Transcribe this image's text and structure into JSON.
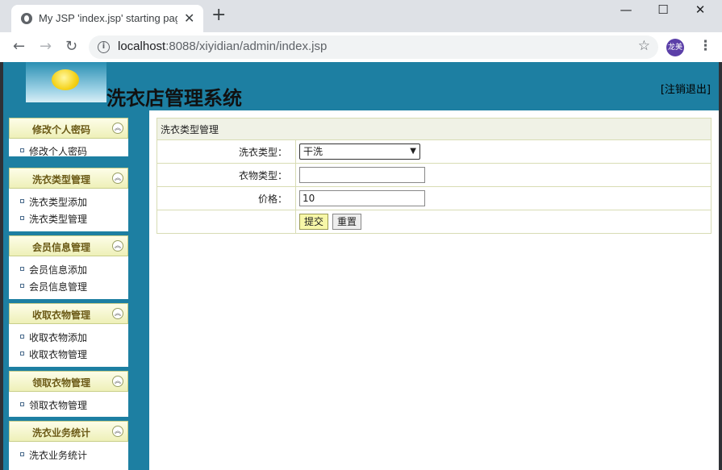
{
  "browser": {
    "tab_title": "My JSP 'index.jsp' starting page",
    "tab_close": "✕",
    "new_tab": "+",
    "url_host": "localhost",
    "url_rest": ":8088/xiyidian/admin/index.jsp",
    "profile_label": "龙美",
    "win_min": "—",
    "win_max": "☐",
    "win_close": "✕"
  },
  "header": {
    "title": "洗衣店管理系统",
    "logout": "[注销退出]"
  },
  "sidebar": {
    "groups": [
      {
        "title": "修改个人密码",
        "items": [
          "修改个人密码"
        ]
      },
      {
        "title": "洗衣类型管理",
        "items": [
          "洗衣类型添加",
          "洗衣类型管理"
        ]
      },
      {
        "title": "会员信息管理",
        "items": [
          "会员信息添加",
          "会员信息管理"
        ]
      },
      {
        "title": "收取衣物管理",
        "items": [
          "收取衣物添加",
          "收取衣物管理"
        ]
      },
      {
        "title": "领取衣物管理",
        "items": [
          "领取衣物管理"
        ]
      },
      {
        "title": "洗衣业务统计",
        "items": [
          "洗衣业务统计"
        ]
      }
    ]
  },
  "form": {
    "caption": "洗衣类型管理",
    "wash_type_label": "洗衣类型：",
    "wash_type_value": "干洗",
    "cloth_type_label": "衣物类型：",
    "cloth_type_value": "",
    "price_label": "价格：",
    "price_value": "10",
    "submit_label": "提交",
    "reset_label": "重置"
  }
}
